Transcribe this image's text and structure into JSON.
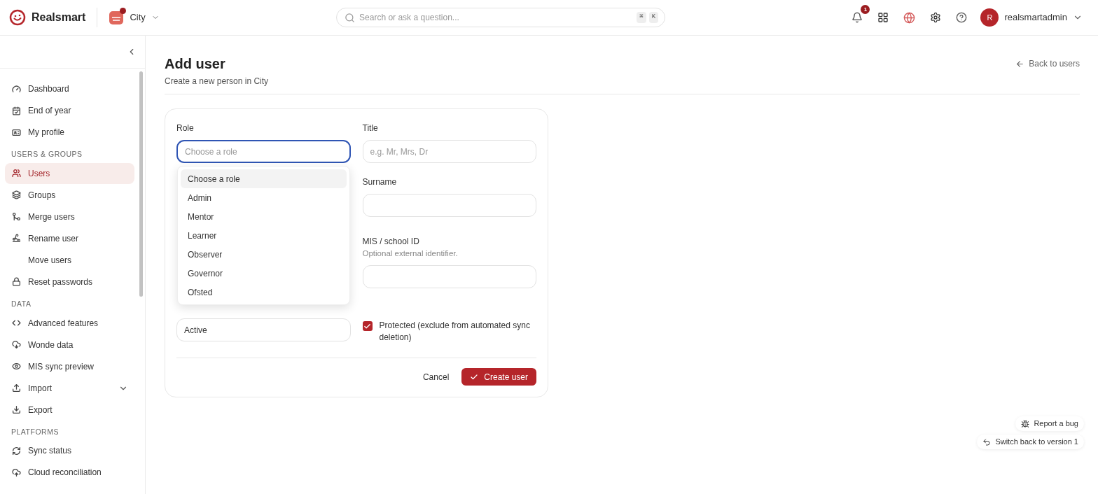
{
  "header": {
    "brand": "Realsmart",
    "school": {
      "name": "City",
      "alert": true
    },
    "search": {
      "placeholder": "Search or ask a question...",
      "keys": [
        "⌘",
        "K"
      ]
    },
    "notifications": {
      "count": "1"
    },
    "user": {
      "initial": "R",
      "name": "realsmartadmin"
    }
  },
  "sidebar": {
    "sections": [
      {
        "items": [
          {
            "label": "Dashboard",
            "selected": false
          },
          {
            "label": "End of year",
            "selected": false
          },
          {
            "label": "My profile",
            "selected": false
          }
        ]
      },
      {
        "heading": "USERS & GROUPS",
        "items": [
          {
            "label": "Users",
            "selected": true
          },
          {
            "label": "Groups",
            "selected": false
          },
          {
            "label": "Merge users",
            "selected": false
          },
          {
            "label": "Rename user",
            "selected": false
          },
          {
            "label": "Move users",
            "selected": false
          },
          {
            "label": "Reset passwords",
            "selected": false
          }
        ]
      },
      {
        "heading": "DATA",
        "items": [
          {
            "label": "Advanced features",
            "selected": false
          },
          {
            "label": "Wonde data",
            "selected": false
          },
          {
            "label": "MIS sync preview",
            "selected": false
          },
          {
            "label": "Import",
            "selected": false,
            "expandable": true
          },
          {
            "label": "Export",
            "selected": false
          }
        ]
      },
      {
        "heading": "PLATFORMS",
        "items": [
          {
            "label": "Sync status",
            "selected": false
          },
          {
            "label": "Cloud reconciliation",
            "selected": false
          }
        ]
      }
    ]
  },
  "page": {
    "title": "Add user",
    "subtitle": "Create a new person in City",
    "back_link": "Back to users"
  },
  "form": {
    "role": {
      "label": "Role",
      "placeholder": "Choose a role",
      "expanded": true,
      "options": [
        {
          "label": "Choose a role",
          "selected": true
        },
        {
          "label": "Admin",
          "selected": false
        },
        {
          "label": "Mentor",
          "selected": false
        },
        {
          "label": "Learner",
          "selected": false
        },
        {
          "label": "Observer",
          "selected": false
        },
        {
          "label": "Governor",
          "selected": false
        },
        {
          "label": "Ofsted",
          "selected": false
        }
      ]
    },
    "title": {
      "label": "Title",
      "placeholder": "e.g. Mr, Mrs, Dr"
    },
    "surname": {
      "label": "Surname"
    },
    "mis_id": {
      "label": "MIS / school ID",
      "help": "Optional external identifier."
    },
    "status": {
      "value": "Active"
    },
    "protected": {
      "label": "Protected (exclude from automated sync deletion)",
      "checked": true
    },
    "buttons": {
      "cancel": "Cancel",
      "submit": "Create user"
    }
  },
  "floating": {
    "report_bug": "Report a bug",
    "switch_back": "Switch back to version 1"
  }
}
